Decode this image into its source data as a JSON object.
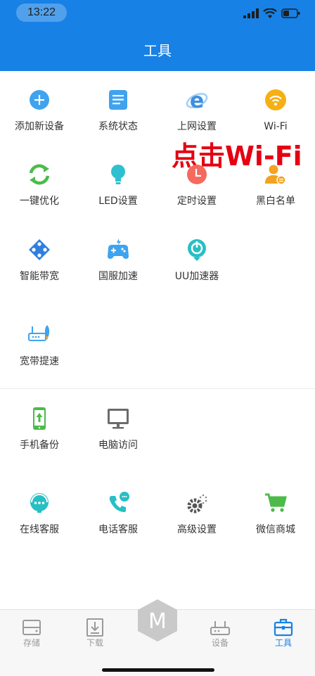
{
  "status": {
    "time": "13:22"
  },
  "header": {
    "title": "工具"
  },
  "annotation": {
    "text": "点击Wi-Fi"
  },
  "tools": [
    {
      "label": "添加新设备",
      "icon": "add-device-icon"
    },
    {
      "label": "系统状态",
      "icon": "system-status-icon"
    },
    {
      "label": "上网设置",
      "icon": "internet-settings-icon"
    },
    {
      "label": "Wi-Fi",
      "icon": "wifi-icon"
    },
    {
      "label": "一键优化",
      "icon": "optimize-icon"
    },
    {
      "label": "LED设置",
      "icon": "led-bulb-icon"
    },
    {
      "label": "定时设置",
      "icon": "timer-icon"
    },
    {
      "label": "黑白名单",
      "icon": "blacklist-icon"
    },
    {
      "label": "智能带宽",
      "icon": "gamepad-icon"
    },
    {
      "label": "国服加速",
      "icon": "game-accelerate-icon"
    },
    {
      "label": "UU加速器",
      "icon": "uu-accelerator-icon"
    },
    {
      "label": "宽带提速",
      "icon": "broadband-boost-icon"
    },
    {
      "label": "手机备份",
      "icon": "phone-backup-icon"
    },
    {
      "label": "电脑访问",
      "icon": "computer-access-icon"
    },
    {
      "label": "在线客服",
      "icon": "online-service-icon"
    },
    {
      "label": "电话客服",
      "icon": "phone-service-icon"
    },
    {
      "label": "高级设置",
      "icon": "advanced-settings-icon"
    },
    {
      "label": "微信商城",
      "icon": "wechat-shop-icon"
    }
  ],
  "tabbar": {
    "storage": "存储",
    "download": "下载",
    "device": "设备",
    "tools": "工具",
    "center": "M",
    "active_color": "#1781e6",
    "inactive_color": "#9a9a9a"
  }
}
